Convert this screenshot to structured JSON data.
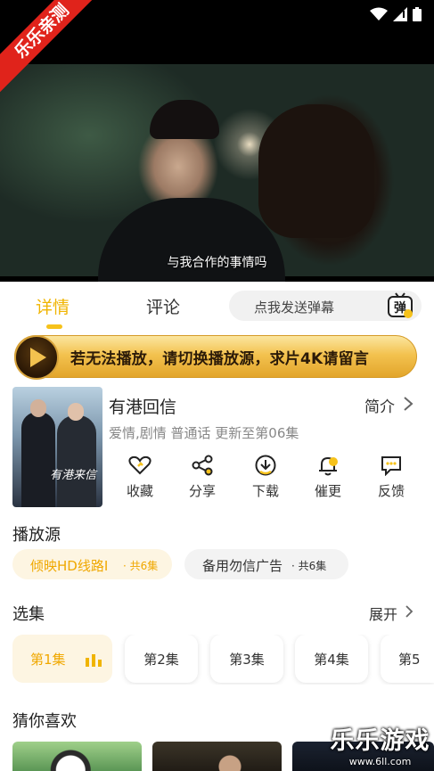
{
  "status_bar": {
    "ribbon": "乐乐亲测"
  },
  "player": {
    "subtitle": "与我合作的事情吗"
  },
  "tabs": {
    "details": "详情",
    "comments": "评论"
  },
  "danmaku": {
    "placeholder": "点我发送弹幕",
    "icon_char": "弹"
  },
  "banner": {
    "text": "若无法播放，请切换播放源，求片4K请留言"
  },
  "show": {
    "title": "有港回信",
    "poster_title": "有港来信",
    "intro": "简介",
    "meta": "爱情,剧情 普通话 更新至第06集"
  },
  "actions": [
    {
      "label": "收藏",
      "icon": "heart-icon"
    },
    {
      "label": "分享",
      "icon": "share-icon"
    },
    {
      "label": "下载",
      "icon": "download-icon"
    },
    {
      "label": "催更",
      "icon": "bell-icon"
    },
    {
      "label": "反馈",
      "icon": "feedback-icon"
    }
  ],
  "source": {
    "title": "播放源",
    "items": [
      {
        "name": "倾映HD线路I",
        "count": "· 共6集"
      },
      {
        "name": "备用勿信广告",
        "count": "· 共6集"
      }
    ]
  },
  "episodes": {
    "title": "选集",
    "expand": "展开",
    "items": [
      "第1集",
      "第2集",
      "第3集",
      "第4集",
      "第5"
    ]
  },
  "recommend": {
    "title": "猜你喜欢"
  },
  "watermark": {
    "main": "乐乐游戏",
    "url": "www.6ll.com"
  },
  "colors": {
    "accent": "#f0b400",
    "banner": "#f3c24f",
    "ribbon": "#e0231b"
  }
}
